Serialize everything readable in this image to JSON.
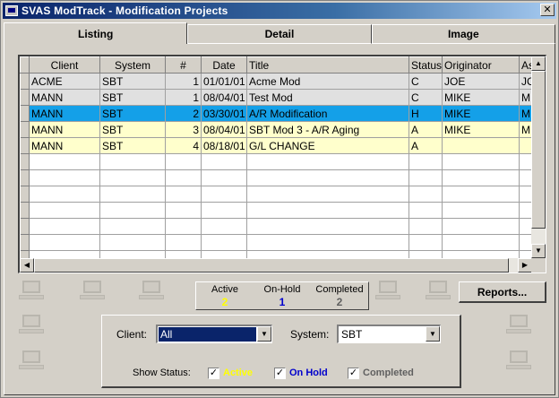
{
  "window": {
    "title": "SVAS ModTrack - Modification Projects",
    "close": "✕"
  },
  "tabs": [
    {
      "label": "Listing",
      "active": true
    },
    {
      "label": "Detail",
      "active": false
    },
    {
      "label": "Image",
      "active": false
    }
  ],
  "grid": {
    "columns": [
      "Client",
      "System",
      "#",
      "Date",
      "Title",
      "Status",
      "Originator",
      "As"
    ],
    "rows": [
      {
        "style": "gray",
        "cells": [
          "ACME",
          "SBT",
          "1",
          "01/01/01",
          "Acme Mod",
          "C",
          "JOE",
          "JC"
        ]
      },
      {
        "style": "gray",
        "cells": [
          "MANN",
          "SBT",
          "1",
          "08/04/01",
          "Test Mod",
          "C",
          "MIKE",
          "MI"
        ]
      },
      {
        "style": "blue",
        "cells": [
          "MANN",
          "SBT",
          "2",
          "03/30/01",
          "A/R Modification",
          "H",
          "MIKE",
          "MI"
        ]
      },
      {
        "style": "yellow",
        "cells": [
          "MANN",
          "SBT",
          "3",
          "08/04/01",
          "SBT Mod 3 - A/R Aging",
          "A",
          "MIKE",
          "MI"
        ]
      },
      {
        "style": "yellow",
        "cells": [
          "MANN",
          "SBT",
          "4",
          "08/18/01",
          "G/L CHANGE",
          "A",
          "",
          ""
        ]
      }
    ],
    "empty_rows": 7
  },
  "counts": {
    "active": {
      "label": "Active",
      "value": "2",
      "color": "#ffff00"
    },
    "on_hold": {
      "label": "On-Hold",
      "value": "1",
      "color": "#0000cc"
    },
    "completed": {
      "label": "Completed",
      "value": "2",
      "color": "#606060"
    }
  },
  "reports_button": "Reports...",
  "filters": {
    "client_label": "Client:",
    "client_value": "All",
    "system_label": "System:",
    "system_value": "SBT",
    "show_status_label": "Show Status:",
    "status_checks": [
      {
        "label": "Active",
        "checked": true,
        "color": "#ffff00"
      },
      {
        "label": "On Hold",
        "checked": true,
        "color": "#0000cc"
      },
      {
        "label": "Completed",
        "checked": true,
        "color": "#606060"
      }
    ]
  },
  "icons": {
    "dropdown": "▼",
    "up": "▲",
    "down": "▼",
    "left": "◀",
    "right": "▶",
    "check": "✓"
  }
}
